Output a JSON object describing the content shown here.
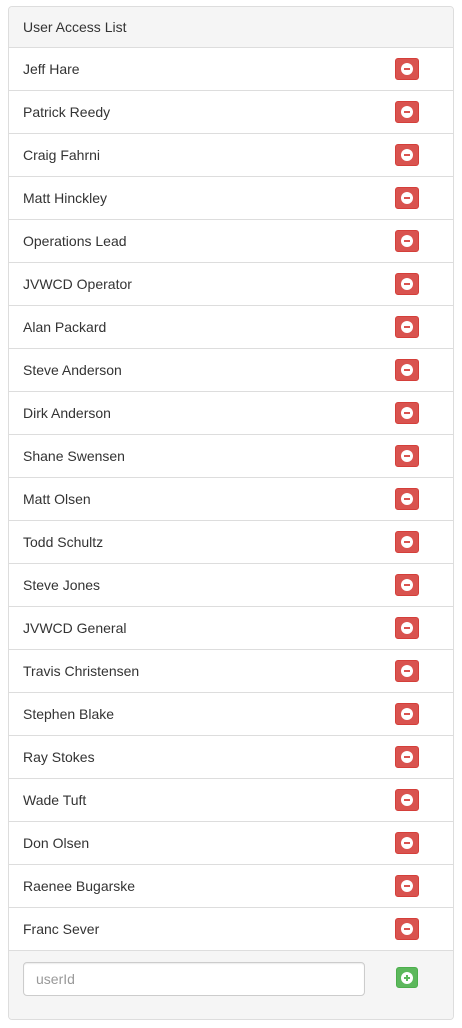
{
  "panel": {
    "title": "User Access List"
  },
  "users": [
    {
      "name": "Jeff Hare"
    },
    {
      "name": "Patrick Reedy"
    },
    {
      "name": "Craig Fahrni"
    },
    {
      "name": "Matt Hinckley"
    },
    {
      "name": "Operations Lead"
    },
    {
      "name": "JVWCD Operator"
    },
    {
      "name": "Alan Packard"
    },
    {
      "name": "Steve Anderson"
    },
    {
      "name": "Dirk Anderson"
    },
    {
      "name": "Shane Swensen"
    },
    {
      "name": "Matt Olsen"
    },
    {
      "name": "Todd Schultz"
    },
    {
      "name": "Steve Jones"
    },
    {
      "name": "JVWCD General"
    },
    {
      "name": "Travis Christensen"
    },
    {
      "name": "Stephen Blake"
    },
    {
      "name": "Ray Stokes"
    },
    {
      "name": "Wade Tuft"
    },
    {
      "name": "Don Olsen"
    },
    {
      "name": "Raenee Bugarske"
    },
    {
      "name": "Franc Sever"
    }
  ],
  "footer": {
    "input_value": "",
    "input_placeholder": "userId"
  },
  "icons": {
    "remove": "minus-sign-icon",
    "add": "plus-sign-icon"
  },
  "colors": {
    "remove_button": "#d9534f",
    "add_button": "#5cb85c",
    "panel_heading_bg": "#f5f5f5",
    "border": "#dddddd"
  }
}
